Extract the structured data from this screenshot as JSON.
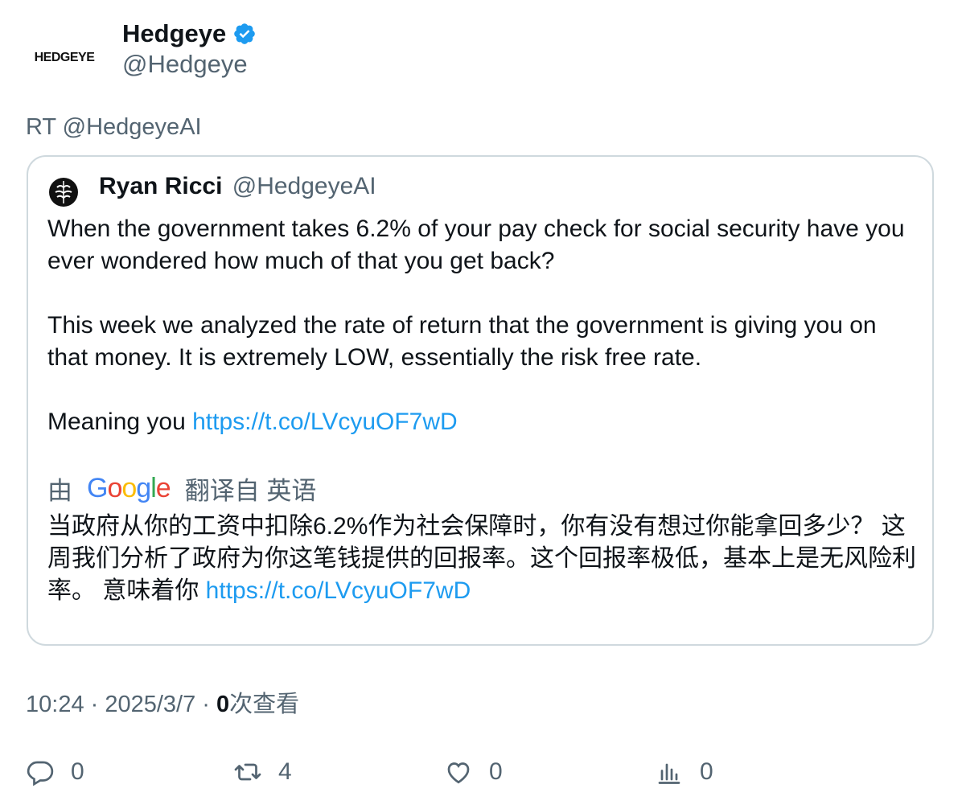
{
  "author": {
    "avatar_text": "HEDGEYE",
    "name": "Hedgeye",
    "handle": "@Hedgeye",
    "verified_icon": "verified-badge-icon"
  },
  "retweet_line": "RT @HedgeyeAI",
  "quote": {
    "author_name": "Ryan Ricci",
    "author_handle": "@HedgeyeAI",
    "paragraph1": "When the government takes 6.2% of your pay check for social security have you ever wondered how much of that you get back?",
    "paragraph2": "This week we analyzed the rate of return that the government is giving you on that money. It is extremely LOW, essentially the risk free rate.",
    "paragraph3_text": "Meaning you ",
    "paragraph3_link": "https://t.co/LVcyuOF7wD",
    "translate_prefix": "由",
    "translate_provider": "Google",
    "translate_suffix": "翻译自 英语",
    "translated_text": "当政府从你的工资中扣除6.2%作为社会保障时，你有没有想过你能拿回多少？ 这周我们分析了政府为你这笔钱提供的回报率。这个回报率极低，基本上是无风险利率。 意味着你 ",
    "translated_link": "https://t.co/LVcyuOF7wD"
  },
  "meta": {
    "time": "10:24",
    "sep1": " · ",
    "date": "2025/3/7",
    "sep2": " · ",
    "views_count": "0",
    "views_label": "次查看"
  },
  "actions": {
    "reply_count": "0",
    "retweet_count": "4",
    "like_count": "0",
    "views_count": "0"
  },
  "colors": {
    "accent": "#1d9bf0",
    "secondary_text": "#536471",
    "border": "#cfd9de"
  }
}
